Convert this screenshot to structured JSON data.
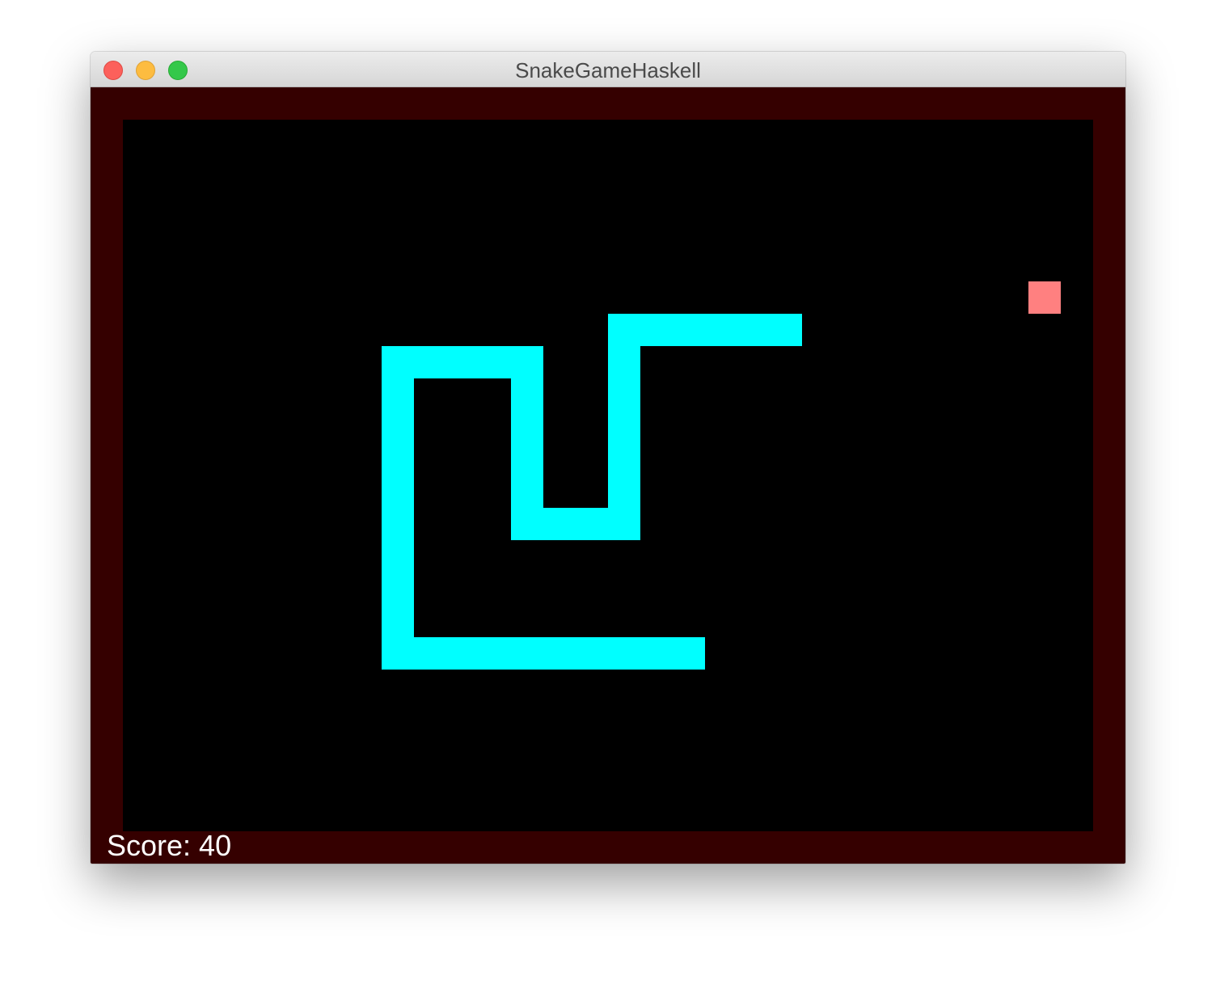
{
  "window": {
    "title": "SnakeGameHaskell",
    "controls": [
      "close-button",
      "minimize-button",
      "maximize-button"
    ]
  },
  "game": {
    "score_text": "Score: 40",
    "grid_unit_px_note": "",
    "colors": {
      "border": "#350000",
      "background": "#000000",
      "snake": "#00ffff",
      "food": "#ff8080",
      "score_text": "#ffffff"
    },
    "grid": {
      "cols": 30,
      "rows": 22
    },
    "food": {
      "col": 28,
      "row": 6
    },
    "snake": [
      [
        20,
        7
      ],
      [
        19,
        7
      ],
      [
        18,
        7
      ],
      [
        17,
        7
      ],
      [
        16,
        7
      ],
      [
        15,
        7
      ],
      [
        15,
        8
      ],
      [
        15,
        9
      ],
      [
        15,
        10
      ],
      [
        15,
        11
      ],
      [
        15,
        12
      ],
      [
        15,
        13
      ],
      [
        14,
        13
      ],
      [
        13,
        13
      ],
      [
        12,
        13
      ],
      [
        12,
        12
      ],
      [
        12,
        11
      ],
      [
        12,
        10
      ],
      [
        12,
        9
      ],
      [
        12,
        8
      ],
      [
        11,
        8
      ],
      [
        10,
        8
      ],
      [
        9,
        8
      ],
      [
        8,
        8
      ],
      [
        8,
        9
      ],
      [
        8,
        10
      ],
      [
        8,
        11
      ],
      [
        8,
        12
      ],
      [
        8,
        13
      ],
      [
        8,
        14
      ],
      [
        8,
        15
      ],
      [
        8,
        16
      ],
      [
        8,
        17
      ],
      [
        9,
        17
      ],
      [
        10,
        17
      ],
      [
        11,
        17
      ],
      [
        12,
        17
      ],
      [
        13,
        17
      ],
      [
        14,
        17
      ],
      [
        15,
        17
      ],
      [
        16,
        17
      ],
      [
        17,
        17
      ]
    ]
  }
}
